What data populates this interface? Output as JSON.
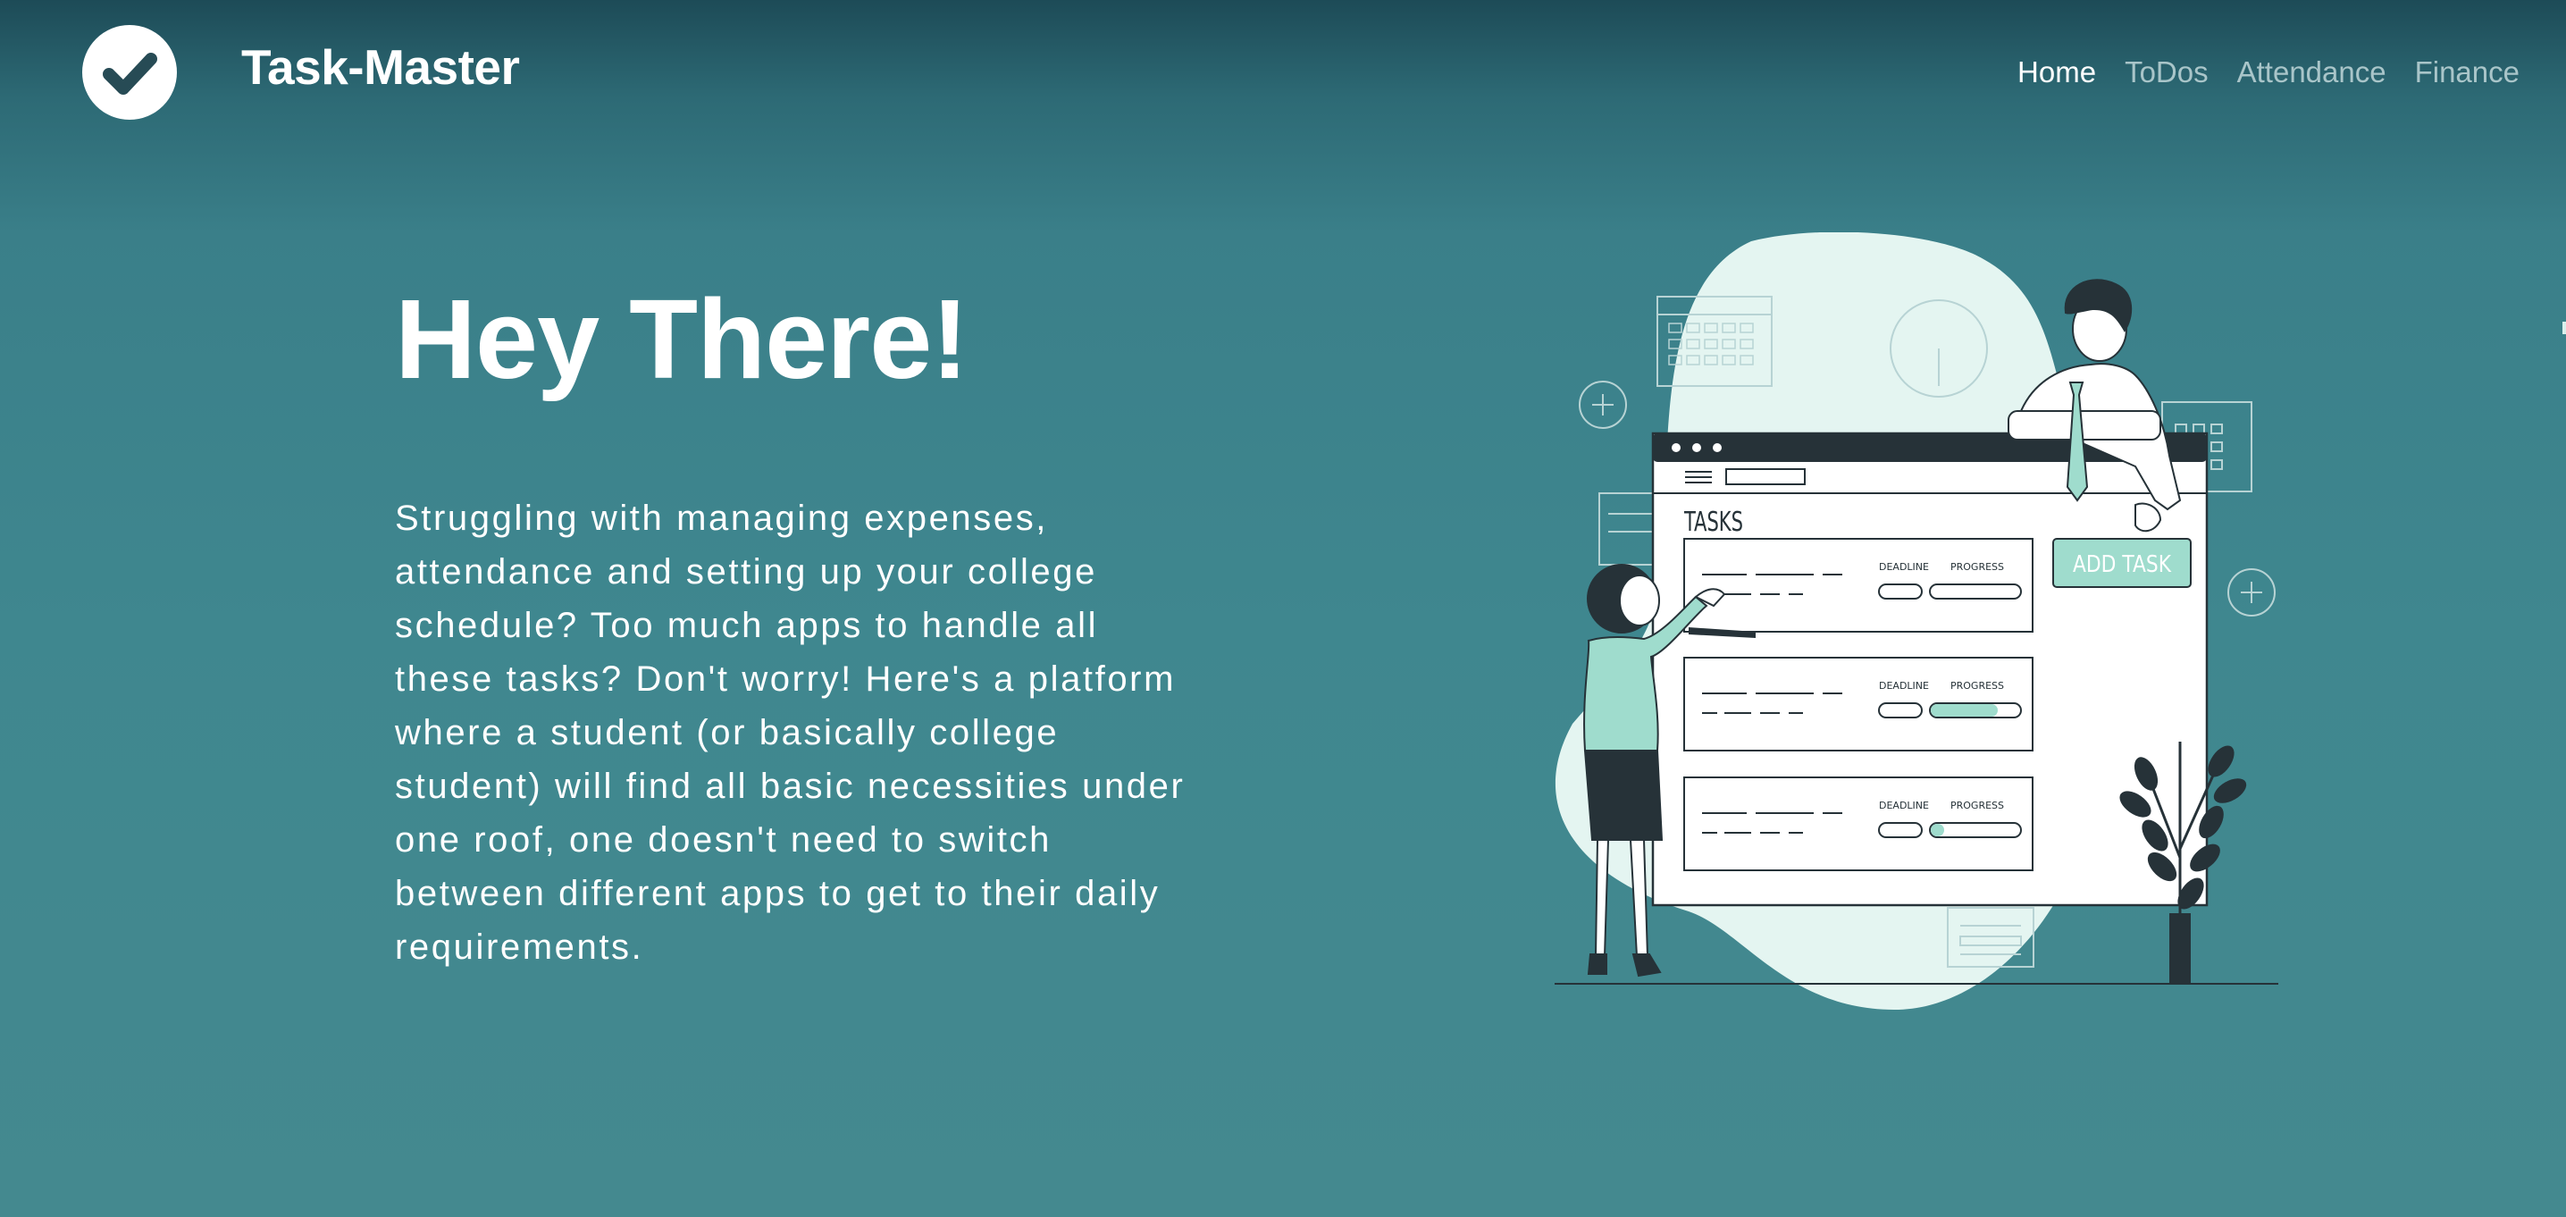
{
  "header": {
    "logo_icon": "check-circle-icon",
    "brand_name": "Task-Master",
    "nav": [
      {
        "label": "Home",
        "active": true
      },
      {
        "label": "ToDos",
        "active": false
      },
      {
        "label": "Attendance",
        "active": false
      },
      {
        "label": "Finance",
        "active": false
      }
    ]
  },
  "hero": {
    "title": "Hey There!",
    "text": "Struggling with managing expenses, attendance and setting up your college schedule? Too much apps to handle all these tasks? Don't worry! Here's a platform where a student (or basically college student) will find all basic necessities under one roof, one doesn't need to switch between different apps to get to their daily requirements."
  },
  "illustration": {
    "icon": "task-board-illustration",
    "tasks_heading": "TASKS",
    "add_task_label": "ADD TASK",
    "rows": [
      {
        "deadline_label": "DEADLINE",
        "progress_label": "PROGRESS",
        "progress": 0.0
      },
      {
        "deadline_label": "DEADLINE",
        "progress_label": "PROGRESS",
        "progress": 0.75
      },
      {
        "deadline_label": "DEADLINE",
        "progress_label": "PROGRESS",
        "progress": 0.15
      }
    ]
  },
  "colors": {
    "accent": "#9fdccd",
    "blob": "#e4f5f1",
    "ink": "#263238",
    "nav_inactive": "#a9c5c9",
    "background_top": "#1d4b57",
    "background_bottom": "#44898f"
  }
}
